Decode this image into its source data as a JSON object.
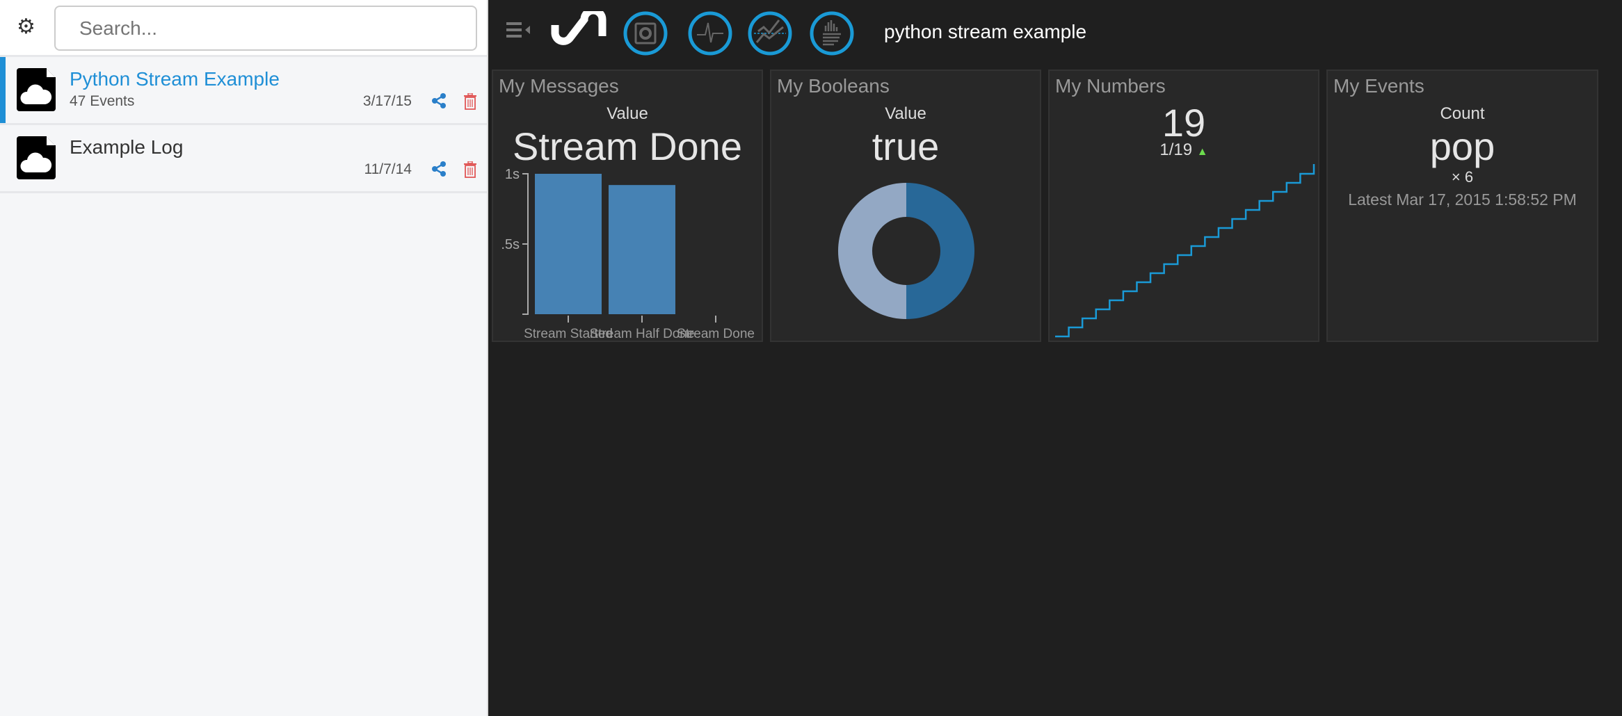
{
  "sidebar": {
    "search_placeholder": "Search...",
    "items": [
      {
        "title": "Python Stream Example",
        "subtitle": "47 Events",
        "date": "3/17/15",
        "active": true
      },
      {
        "title": "Example Log",
        "subtitle": "",
        "date": "11/7/14",
        "active": false
      }
    ]
  },
  "header": {
    "title": "python stream example",
    "icons": [
      "menu-collapse-icon",
      "logo-icon",
      "dashboard-icon",
      "waveform-icon",
      "line-chart-icon",
      "histogram-icon"
    ],
    "accent": "#1a9ad6"
  },
  "panels": {
    "messages": {
      "title": "My Messages",
      "label": "Value",
      "value": "Stream Done"
    },
    "booleans": {
      "title": "My Booleans",
      "label": "Value",
      "value": "true"
    },
    "numbers": {
      "title": "My Numbers",
      "value": "19",
      "sub": "1/19",
      "trend": "up"
    },
    "events": {
      "title": "My Events",
      "label": "Count",
      "value": "pop",
      "count": "× 6",
      "latest": "Latest Mar 17, 2015 1:58:52 PM"
    }
  },
  "chart_data": [
    {
      "type": "bar",
      "categories": [
        "Stream Started",
        "Stream Half Done",
        "Stream Done"
      ],
      "values": [
        1.0,
        0.92,
        0
      ],
      "yticks": [
        "1s",
        ".5s"
      ],
      "ylim": [
        0,
        1
      ],
      "color": "#4682b4"
    },
    {
      "type": "pie",
      "donut": true,
      "slices": [
        {
          "label": "true",
          "value": 50,
          "color": "#286898"
        },
        {
          "label": "false",
          "value": 50,
          "color": "#93a8c4"
        }
      ]
    },
    {
      "type": "line",
      "step": true,
      "x": [
        1,
        2,
        3,
        4,
        5,
        6,
        7,
        8,
        9,
        10,
        11,
        12,
        13,
        14,
        15,
        16,
        17,
        18,
        19
      ],
      "y": [
        1,
        2,
        3,
        4,
        5,
        6,
        7,
        8,
        9,
        10,
        11,
        12,
        13,
        14,
        15,
        16,
        17,
        18,
        19
      ],
      "color": "#1a9ad6"
    }
  ]
}
